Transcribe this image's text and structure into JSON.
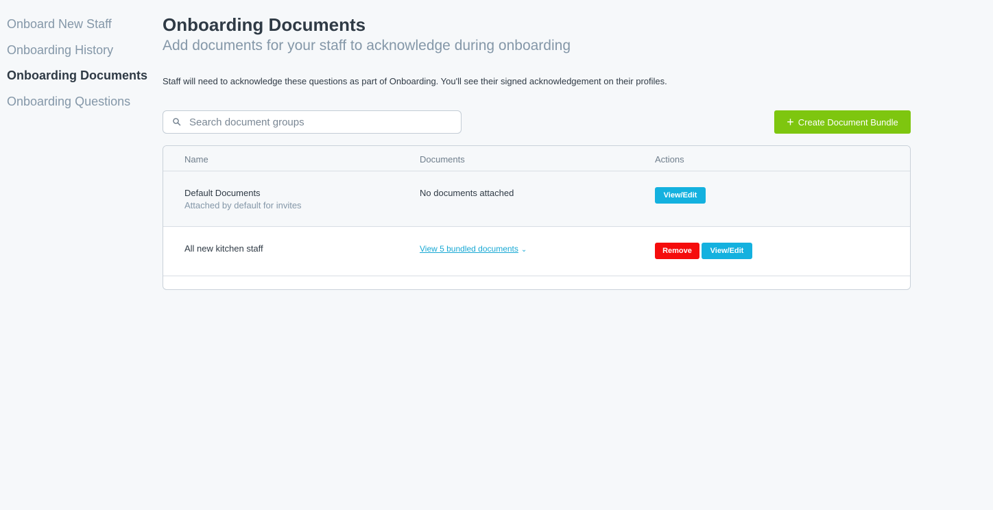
{
  "sidebar": {
    "items": [
      {
        "label": "Onboard New Staff"
      },
      {
        "label": "Onboarding History"
      },
      {
        "label": "Onboarding Documents"
      },
      {
        "label": "Onboarding Questions"
      }
    ]
  },
  "header": {
    "title": "Onboarding Documents",
    "subtitle": "Add documents for your staff to acknowledge during onboarding",
    "description": "Staff will need to acknowledge these questions as part of Onboarding. You'll see their signed acknowledgement on their profiles."
  },
  "search": {
    "placeholder": "Search document groups",
    "icon": "search-icon"
  },
  "create_button": {
    "icon": "+",
    "label": "Create Document Bundle",
    "color": "#7ec60f"
  },
  "table": {
    "columns": [
      "Name",
      "Documents",
      "Actions"
    ],
    "rows": [
      {
        "name": "Default Documents",
        "subtitle": "Attached by default for invites",
        "documents": "No documents attached",
        "actions": [
          "View/Edit"
        ]
      },
      {
        "name": "All new kitchen staff",
        "documents": "View 5 bundled documents",
        "actions": [
          "Remove",
          "View/Edit"
        ]
      }
    ]
  },
  "colors": {
    "accent": "#14b1df",
    "danger": "#f50c0c",
    "success": "#7ec60f"
  }
}
